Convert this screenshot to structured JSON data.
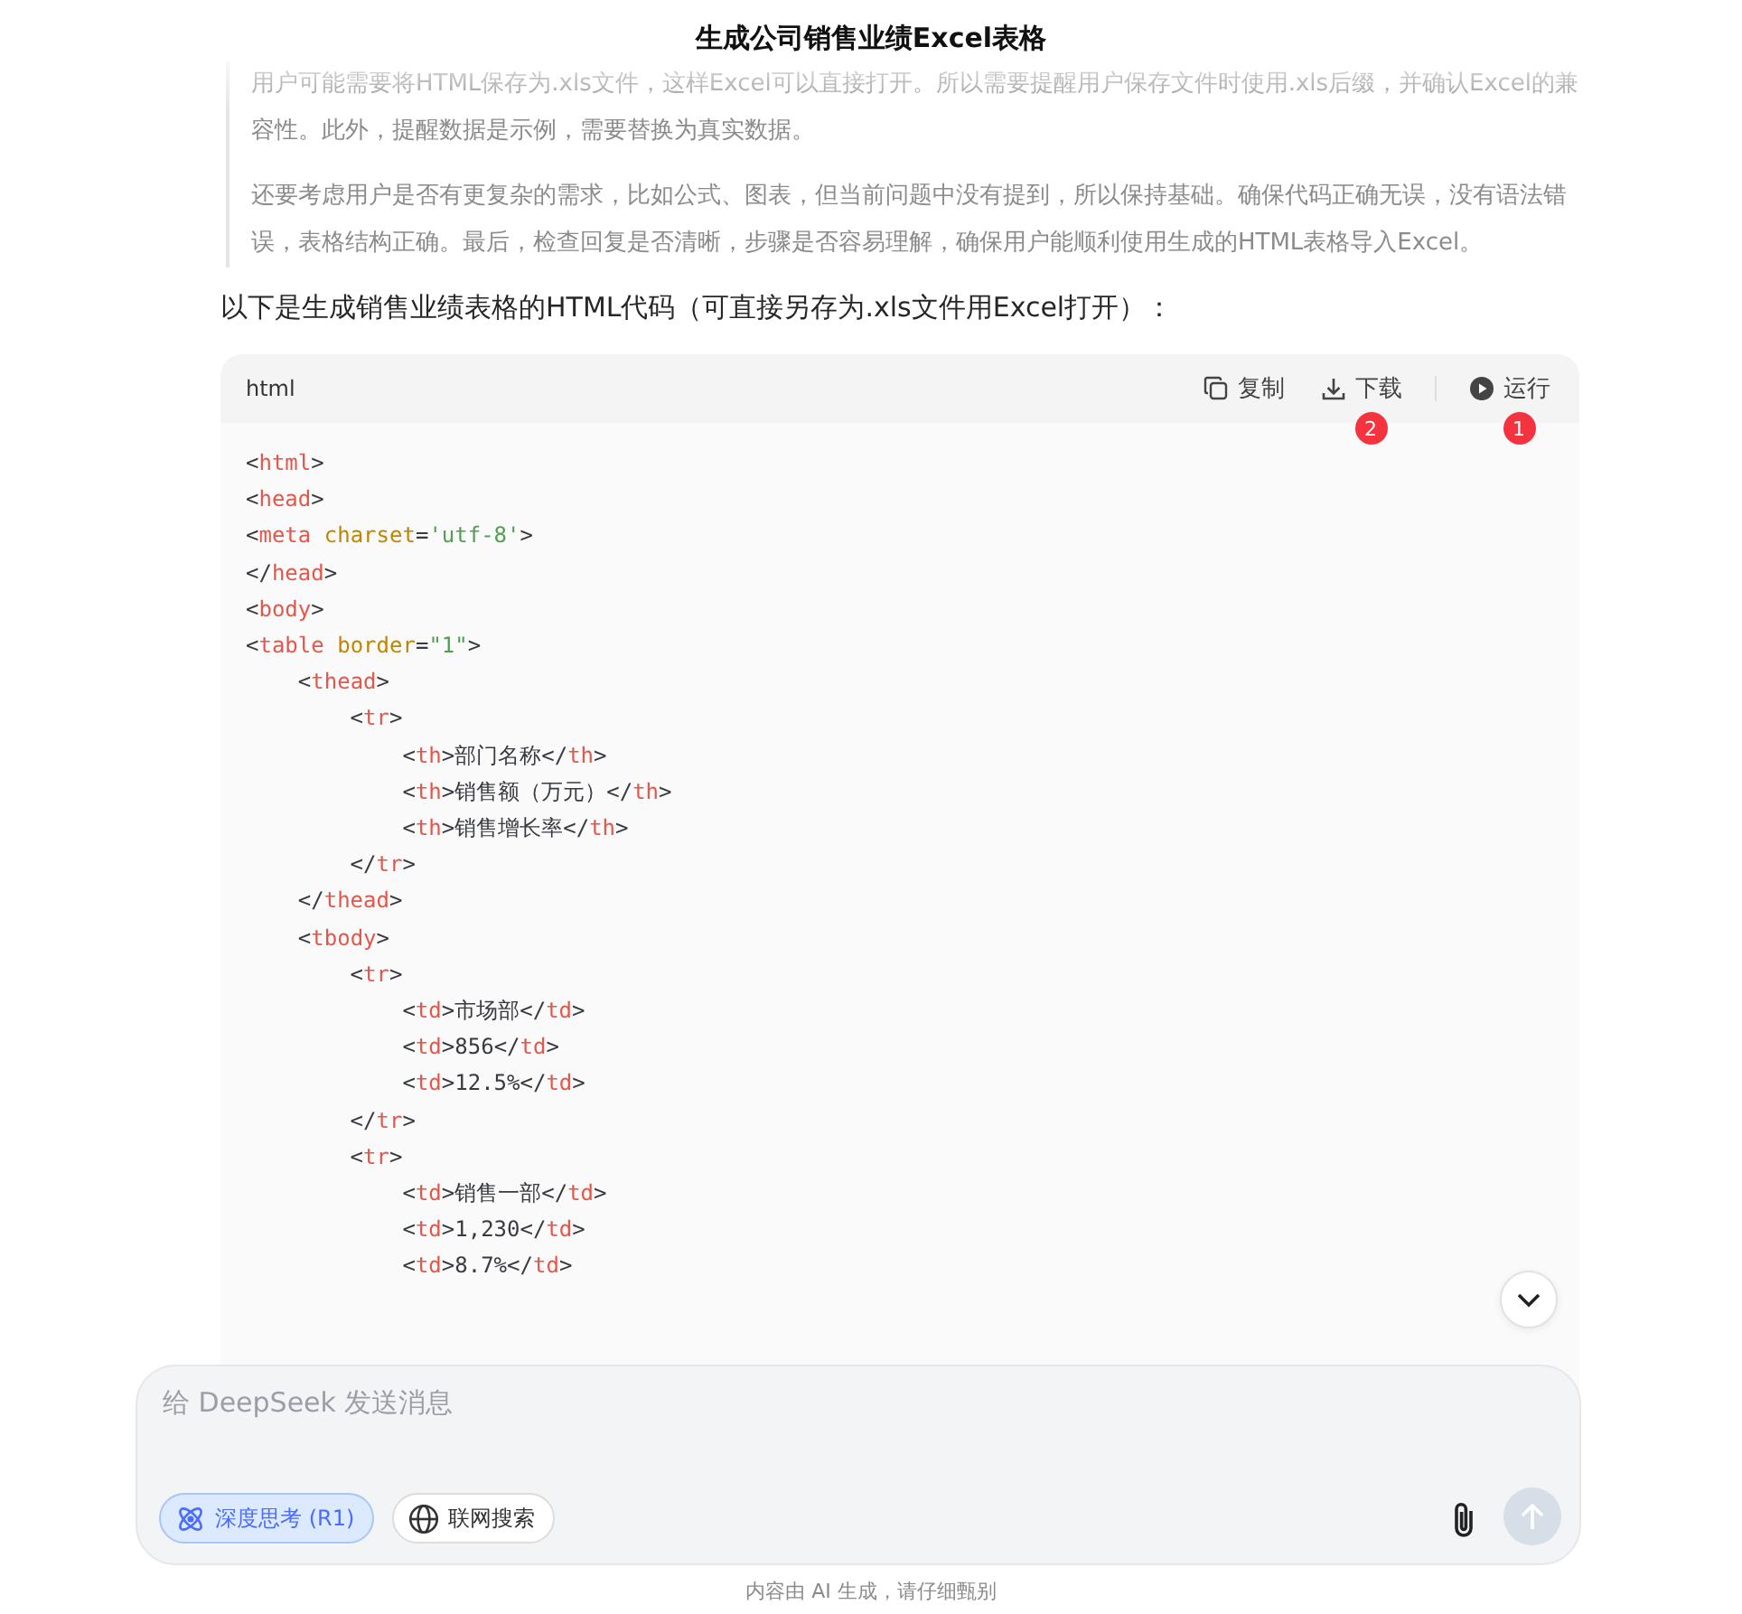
{
  "title": "生成公司销售业绩Excel表格",
  "thinking": [
    "用户可能需要将HTML保存为.xls文件，这样Excel可以直接打开。所以需要提醒用户保存文件时使用.xls后缀，并确认Excel的兼容性。此外，提醒数据是示例，需要替换为真实数据。",
    "还要考虑用户是否有更复杂的需求，比如公式、图表，但当前问题中没有提到，所以保持基础。确保代码正确无误，没有语法错误，表格结构正确。最后，检查回复是否清晰，步骤是否容易理解，确保用户能顺利使用生成的HTML表格导入Excel。"
  ],
  "answer_intro": "以下是生成销售业绩表格的HTML代码（可直接另存为.xls文件用Excel打开）：",
  "code_block": {
    "language": "html",
    "actions": [
      {
        "kind": "copy",
        "label": "复制"
      },
      {
        "kind": "download",
        "label": "下载",
        "badge": "2"
      },
      {
        "kind": "run",
        "label": "运行",
        "badge": "1"
      }
    ],
    "lines": [
      "<html>",
      "<head>",
      "<meta charset='utf-8'>",
      "</head>",
      "<body>",
      "<table border=\"1\">",
      "    <thead>",
      "        <tr>",
      "            <th>部门名称</th>",
      "            <th>销售额（万元）</th>",
      "            <th>销售增长率</th>",
      "        </tr>",
      "    </thead>",
      "    <tbody>",
      "        <tr>",
      "            <td>市场部</td>",
      "            <td>856</td>",
      "            <td>12.5%</td>",
      "        </tr>",
      "        <tr>",
      "            <td>销售一部</td>",
      "            <td>1,230</td>",
      "            <td>8.7%</td>"
    ]
  },
  "composer": {
    "placeholder": "给 DeepSeek 发送消息",
    "toggles": [
      {
        "kind": "deep-think",
        "label": "深度思考 (R1)",
        "selected": true
      },
      {
        "kind": "web-search",
        "label": "联网搜索",
        "selected": false
      }
    ],
    "send_button": {
      "disabled": true
    }
  },
  "footer": "内容由 AI 生成，请仔细甄别"
}
